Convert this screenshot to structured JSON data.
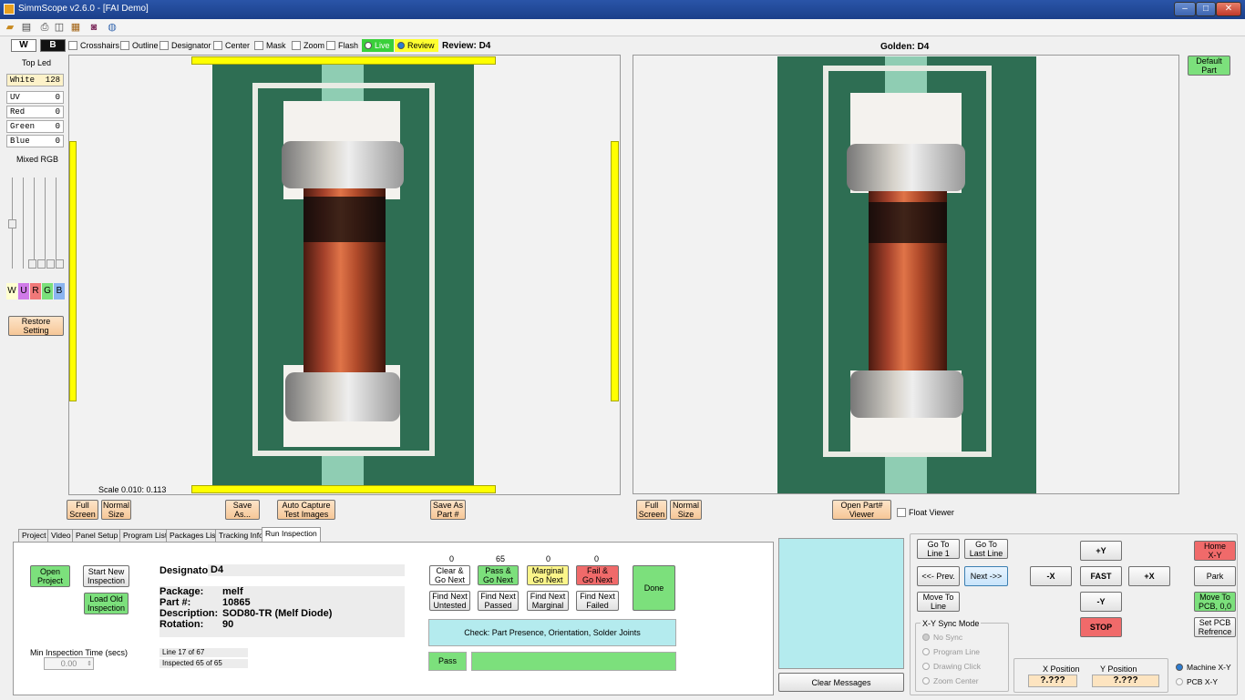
{
  "window": {
    "title": "SimmScope  v2.6.0 - [FAI Demo]"
  },
  "options": {
    "w": "W",
    "b": "B",
    "crosshairs": "Crosshairs",
    "outline": "Outline",
    "designator": "Designator",
    "center": "Center",
    "mask": "Mask",
    "zoom": "Zoom",
    "flash": "Flash",
    "live": "Live",
    "review": "Review",
    "review_label": "Review:  D4"
  },
  "left": {
    "header": "Top Led",
    "rows": [
      {
        "name": "White",
        "value": "128"
      },
      {
        "name": "UV",
        "value": "0"
      },
      {
        "name": "Red",
        "value": "0"
      },
      {
        "name": "Green",
        "value": "0"
      },
      {
        "name": "Blue",
        "value": "0"
      }
    ],
    "mixed": "Mixed RGB",
    "letters": [
      "W",
      "U",
      "R",
      "G",
      "B"
    ],
    "restore": "Restore\nSetting"
  },
  "viewer": {
    "scale": "Scale 0.010:  0.113",
    "golden": "Golden:  D4",
    "default_part": "Default\nPart"
  },
  "viewer_buttons": {
    "full": "Full\nScreen",
    "normal": "Normal\nSize",
    "save_as": "Save\nAs...",
    "auto_capture": "Auto Capture\nTest Images",
    "save_part": "Save As\nPart #",
    "full2": "Full\nScreen",
    "normal2": "Normal\nSize",
    "open_part": "Open Part#\nViewer",
    "float": "Float Viewer"
  },
  "tabs": [
    "Project",
    "Video",
    "Panel Setup",
    "Program List",
    "Packages List",
    "Tracking Info",
    "Run Inspection"
  ],
  "inspection": {
    "open_project": "Open\nProject",
    "start_new": "Start New\nInspection",
    "load_old": "Load Old\nInspection",
    "designator_label": "Designator:",
    "designator": "D4",
    "package_label": "Package:",
    "package": "melf",
    "part_label": "Part #:",
    "part": "10865",
    "desc_label": "Description:",
    "desc": "SOD80-TR  (Melf Diode)",
    "rot_label": "Rotation:",
    "rot": "90",
    "min_time_label": "Min Inspection Time (secs)",
    "min_time": "0.00",
    "line": "Line 17 of 67",
    "inspected": "Inspected 65 of 65",
    "counts": [
      "0",
      "65",
      "0",
      "0"
    ],
    "clear_go": "Clear &\nGo Next",
    "pass_go": "Pass &\nGo Next",
    "marginal_go": "Marginal\nGo Next",
    "fail_go": "Fail &\nGo Next",
    "done": "Done",
    "find_untested": "Find Next\nUntested",
    "find_passed": "Find Next\nPassed",
    "find_marginal": "Find Next\nMarginal",
    "find_failed": "Find Next\nFailed",
    "check": "Check: Part Presence, Orientation, Solder Joints",
    "pass": "Pass"
  },
  "messages": {
    "clear": "Clear Messages"
  },
  "nav": {
    "go_line1": "Go To\nLine 1",
    "go_last": "Go To\nLast Line",
    "prev": "<<- Prev.",
    "next": "Next ->>",
    "move_line": "Move To\nLine",
    "sync_title": "X-Y  Sync Mode",
    "sync": [
      "No Sync",
      "Program Line",
      "Drawing Click",
      "Zoom Center"
    ]
  },
  "motion": {
    "plus_y": "+Y",
    "minus_x": "-X",
    "fast": "FAST",
    "plus_x": "+X",
    "minus_y": "-Y",
    "stop": "STOP",
    "home": "Home\nX-Y",
    "park": "Park",
    "move_pcb": "Move To\nPCB, 0,0",
    "set_pcb": "Set PCB\nRefrence",
    "x_label": "X Position",
    "y_label": "Y Position",
    "x_val": "?.???",
    "y_val": "?.???",
    "machine": "Machine X-Y",
    "pcb": "PCB X-Y"
  },
  "colors": {
    "yellow": "#ffff00",
    "green": "#7ce07c",
    "red": "#f06a6a",
    "cyan": "#b4ebee"
  }
}
